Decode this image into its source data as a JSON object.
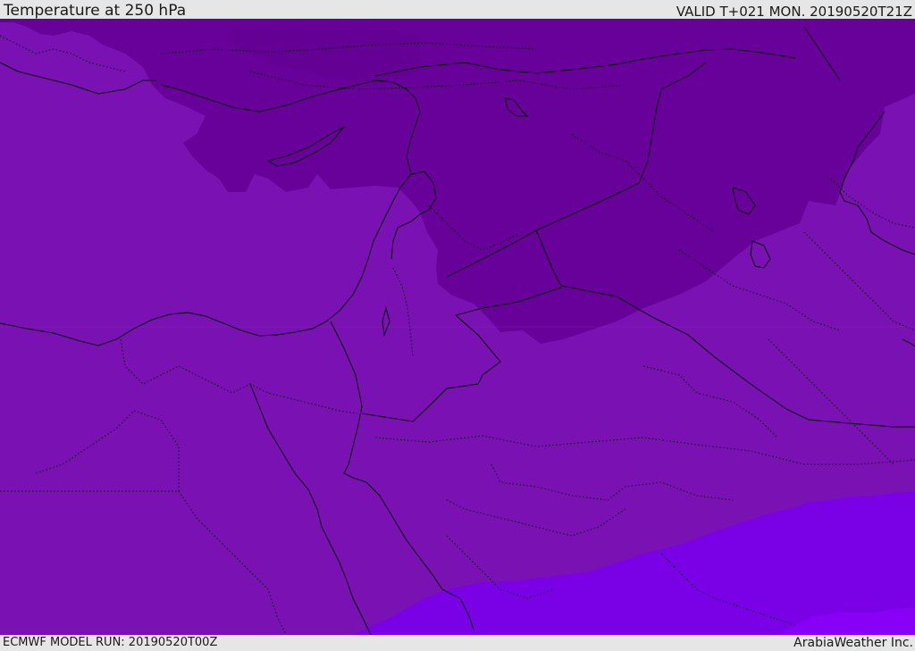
{
  "header": {
    "title": "Temperature at 250 hPa",
    "valid_time": "VALID T+021 MON. 20190520T21Z"
  },
  "footer": {
    "model_run": "ECMWF MODEL RUN: 20190520T00Z",
    "credit": "ArabiaWeather Inc."
  },
  "colors": {
    "cold_band": "#680199",
    "mid_band": "#7a12b3",
    "warm_band": "#7a00e6",
    "warmest_band": "#8800f5",
    "border_line": "#000000",
    "chrome": "#e6e6e6"
  }
}
